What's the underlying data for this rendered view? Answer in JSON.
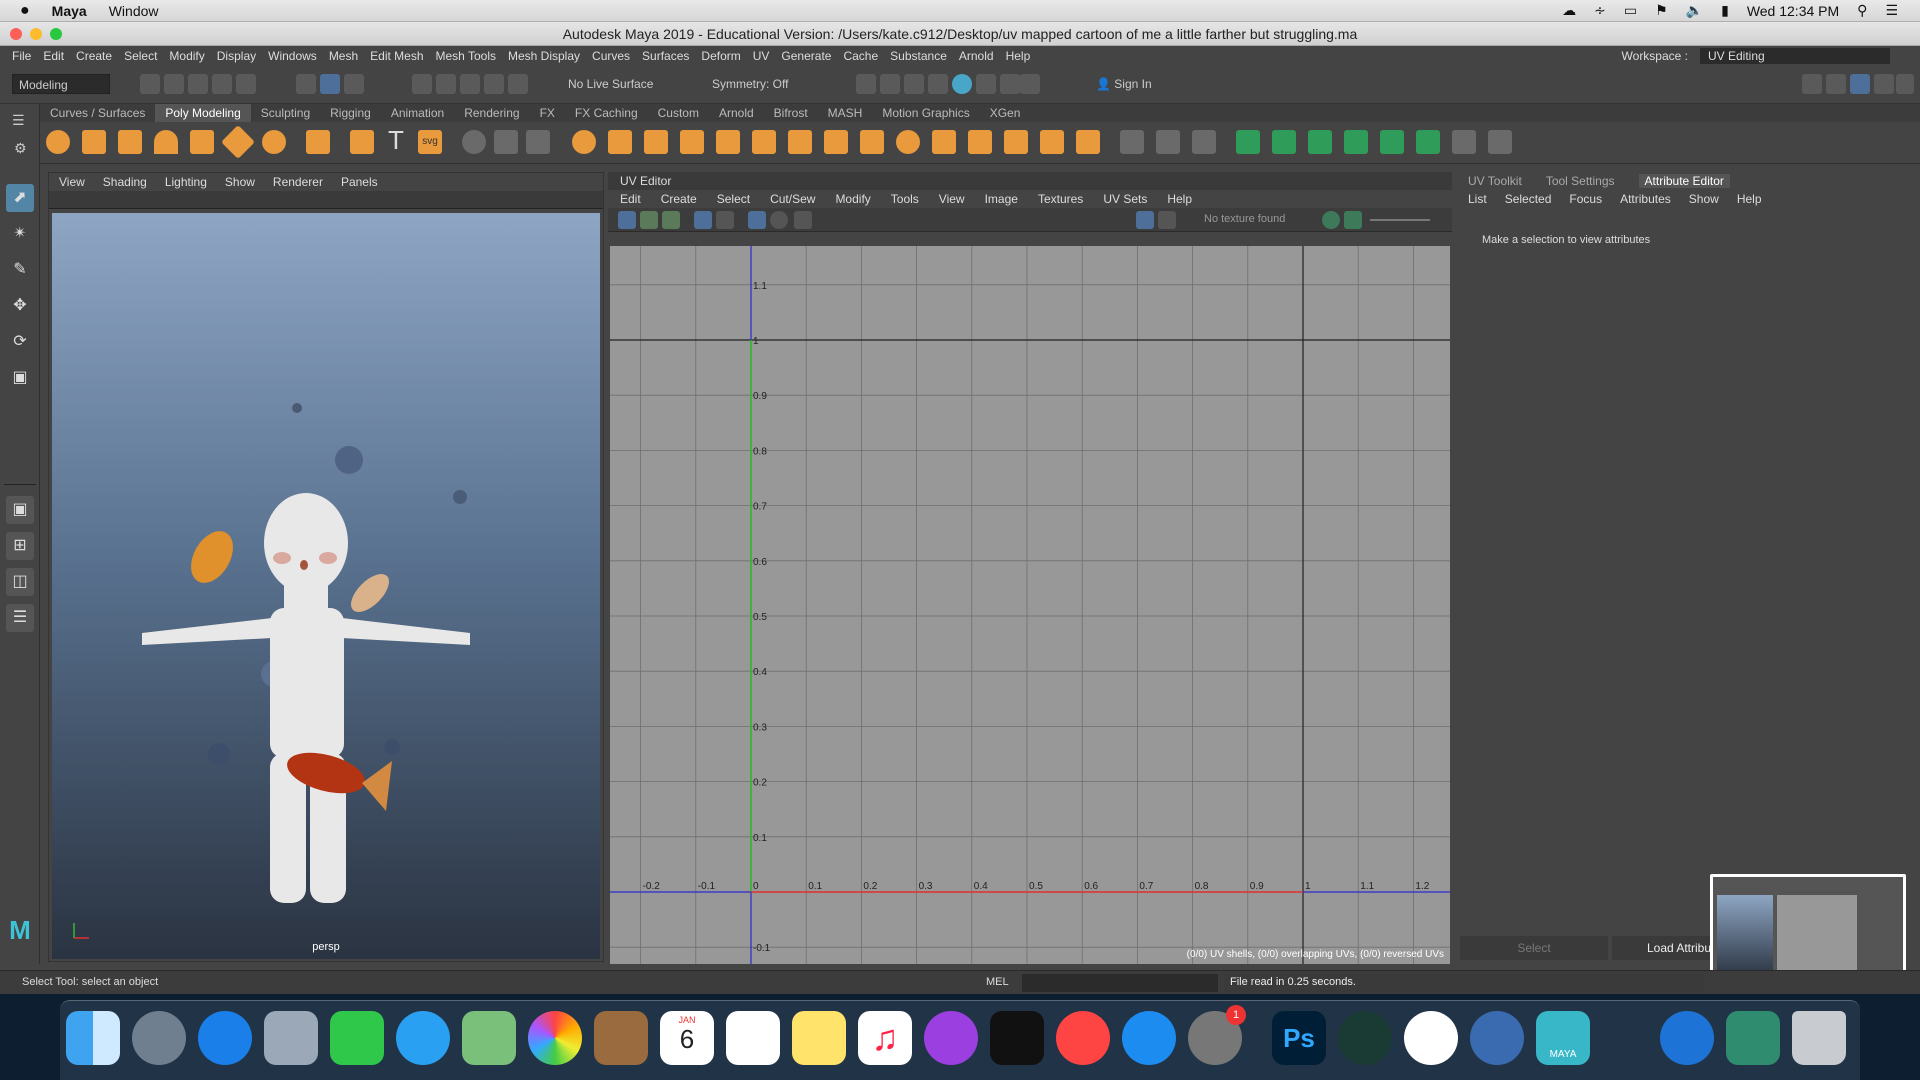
{
  "macos": {
    "apple": "",
    "app": "Maya",
    "menu_window": "Window",
    "datetime": "Wed 12:34 PM"
  },
  "window": {
    "title": "Autodesk Maya 2019 - Educational Version: /Users/kate.c912/Desktop/uv mapped cartoon of me a little farther but struggling.ma"
  },
  "menus": [
    "File",
    "Edit",
    "Create",
    "Select",
    "Modify",
    "Display",
    "Windows",
    "Mesh",
    "Edit Mesh",
    "Mesh Tools",
    "Mesh Display",
    "Curves",
    "Surfaces",
    "Deform",
    "UV",
    "Generate",
    "Cache",
    "Substance",
    "Arnold",
    "Help"
  ],
  "workspace": {
    "label": "Workspace :",
    "value": "UV Editing"
  },
  "statusbar": {
    "mode": "Modeling",
    "live_surface": "No Live Surface",
    "symmetry": "Symmetry: Off",
    "signin": "Sign In"
  },
  "shelf_tabs": [
    "Curves / Surfaces",
    "Poly Modeling",
    "Sculpting",
    "Rigging",
    "Animation",
    "Rendering",
    "FX",
    "FX Caching",
    "Custom",
    "Arnold",
    "Bifrost",
    "MASH",
    "Motion Graphics",
    "XGen"
  ],
  "shelf_active": "Poly Modeling",
  "viewport": {
    "menus": [
      "View",
      "Shading",
      "Lighting",
      "Show",
      "Renderer",
      "Panels"
    ],
    "camera": "persp"
  },
  "uv_editor": {
    "title": "UV Editor",
    "menus": [
      "Edit",
      "Create",
      "Select",
      "Cut/Sew",
      "Modify",
      "Tools",
      "View",
      "Image",
      "Textures",
      "UV Sets",
      "Help"
    ],
    "texture": "No texture found",
    "footer": "(0/0) UV shells, (0/0) overlapping UVs, (0/0) reversed UVs",
    "u_labels": [
      "-0.2",
      "-0.1",
      "0",
      "0.1",
      "0.2",
      "0.3",
      "0.4",
      "0.5",
      "0.6",
      "0.7",
      "0.8",
      "0.9",
      "1",
      "1.1",
      "1.2"
    ],
    "v_labels": [
      "1.1",
      "1",
      "0.9",
      "0.8",
      "0.7",
      "0.6",
      "0.5",
      "0.4",
      "0.3",
      "0.2",
      "0.1",
      "-0.1"
    ]
  },
  "attribute_editor": {
    "tabs": [
      "UV Toolkit",
      "Tool Settings",
      "Attribute Editor"
    ],
    "active_tab": "Attribute Editor",
    "menus": [
      "List",
      "Selected",
      "Focus",
      "Attributes",
      "Show",
      "Help"
    ],
    "message": "Make a selection to view attributes",
    "btn_select": "Select",
    "btn_load": "Load Attributes"
  },
  "bottom": {
    "help": "Select Tool: select an object",
    "mel": "MEL",
    "result": "File read in  0.25 seconds."
  },
  "dock": {
    "calendar_month": "JAN",
    "calendar_day": "6",
    "badge": "1",
    "ps_label": "Ps",
    "maya_label": "MAYA"
  }
}
